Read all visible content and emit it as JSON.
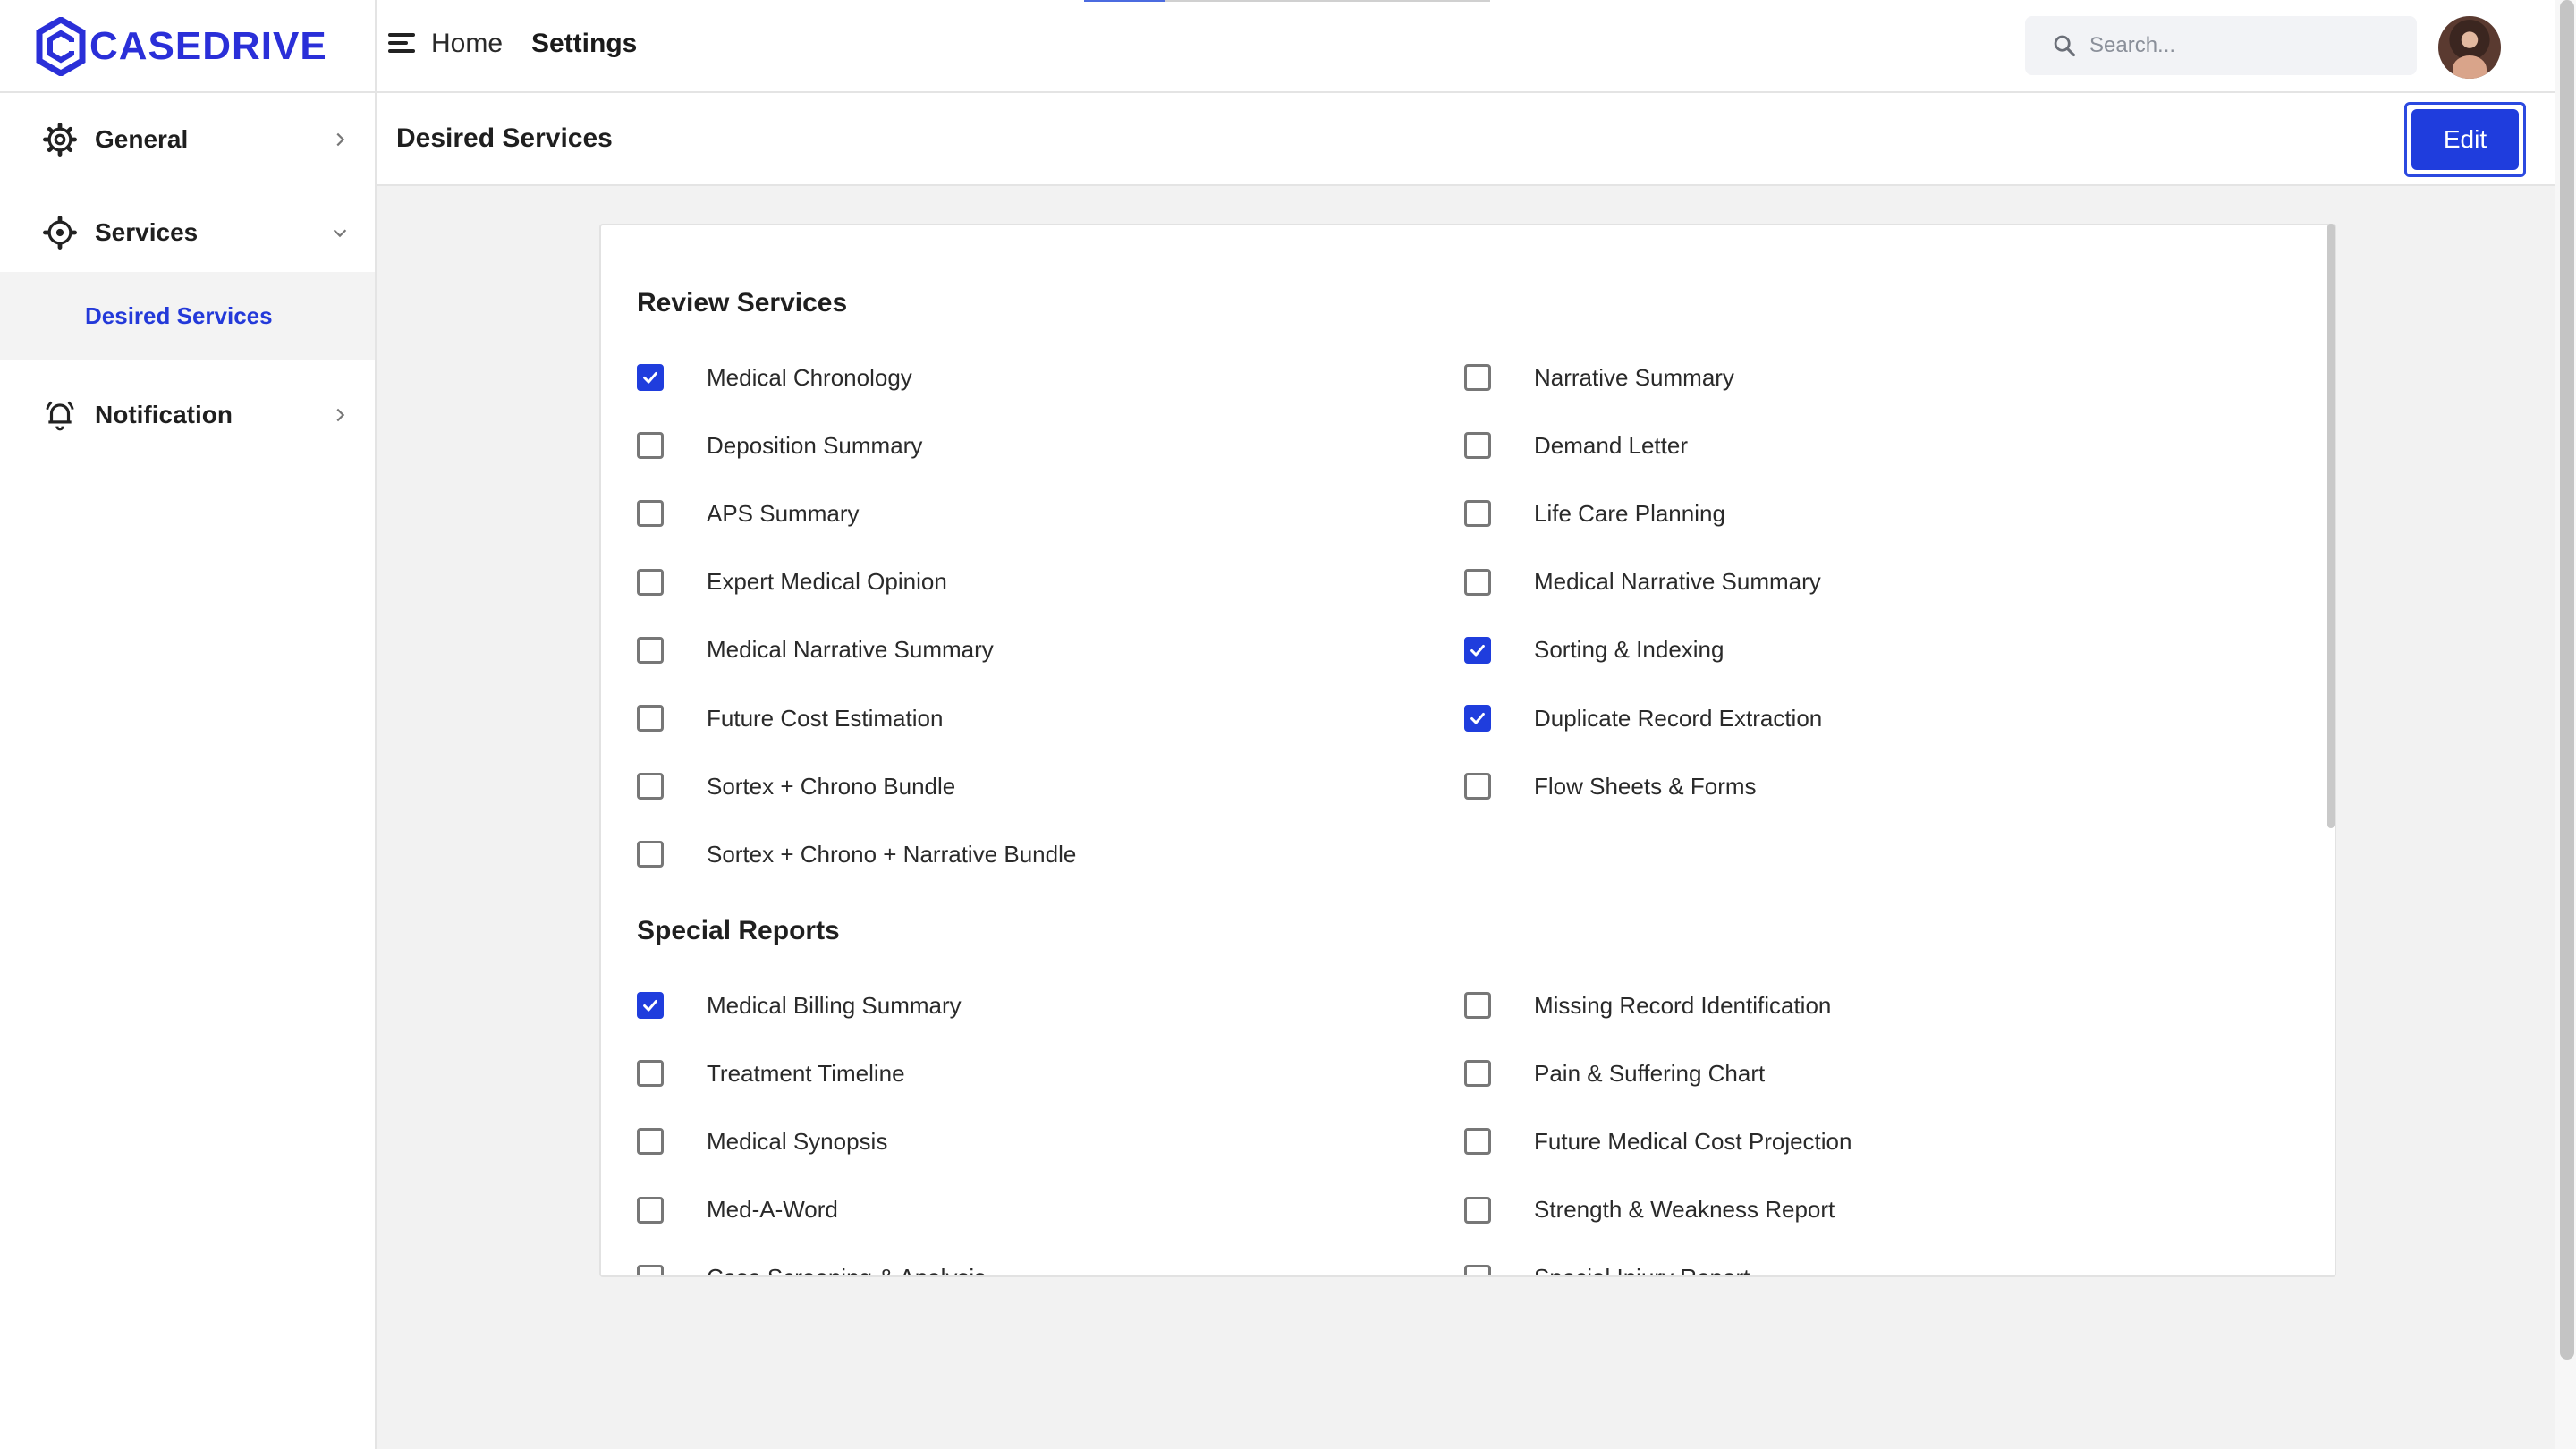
{
  "brand": {
    "logo_text": "CASEDRIVE",
    "accent": "#1f3ddd"
  },
  "header": {
    "home": "Home",
    "current": "Settings",
    "search_placeholder": "Search...",
    "page_load_progress": 0.2
  },
  "sidebar": {
    "general": "General",
    "services": "Services",
    "desired_services": "Desired Services",
    "notification": "Notification"
  },
  "subheader": {
    "title": "Desired Services",
    "edit_label": "Edit"
  },
  "sections": [
    {
      "title": "Review Services",
      "left": [
        {
          "label": "Medical Chronology",
          "checked": true
        },
        {
          "label": "Deposition Summary",
          "checked": false
        },
        {
          "label": "APS Summary",
          "checked": false
        },
        {
          "label": "Expert Medical Opinion",
          "checked": false
        },
        {
          "label": "Medical Narrative Summary",
          "checked": false
        },
        {
          "label": "Future Cost Estimation",
          "checked": false
        },
        {
          "label": "Sortex + Chrono Bundle",
          "checked": false
        },
        {
          "label": "Sortex + Chrono + Narrative Bundle",
          "checked": false
        }
      ],
      "right": [
        {
          "label": "Narrative Summary",
          "checked": false
        },
        {
          "label": "Demand Letter",
          "checked": false
        },
        {
          "label": "Life Care Planning",
          "checked": false
        },
        {
          "label": "Medical Narrative Summary",
          "checked": false
        },
        {
          "label": "Sorting & Indexing",
          "checked": true
        },
        {
          "label": "Duplicate Record Extraction",
          "checked": true
        },
        {
          "label": "Flow Sheets & Forms",
          "checked": false
        }
      ]
    },
    {
      "title": "Special Reports",
      "left": [
        {
          "label": "Medical Billing Summary",
          "checked": true
        },
        {
          "label": "Treatment Timeline",
          "checked": false
        },
        {
          "label": "Medical Synopsis",
          "checked": false
        },
        {
          "label": "Med-A-Word",
          "checked": false
        },
        {
          "label": "Case Screening & Analysis",
          "checked": false
        }
      ],
      "right": [
        {
          "label": "Missing Record Identification",
          "checked": false
        },
        {
          "label": "Pain & Suffering Chart",
          "checked": false
        },
        {
          "label": "Future Medical Cost Projection",
          "checked": false
        },
        {
          "label": "Strength & Weakness Report",
          "checked": false
        },
        {
          "label": "Special Injury Report",
          "checked": false
        }
      ]
    }
  ]
}
